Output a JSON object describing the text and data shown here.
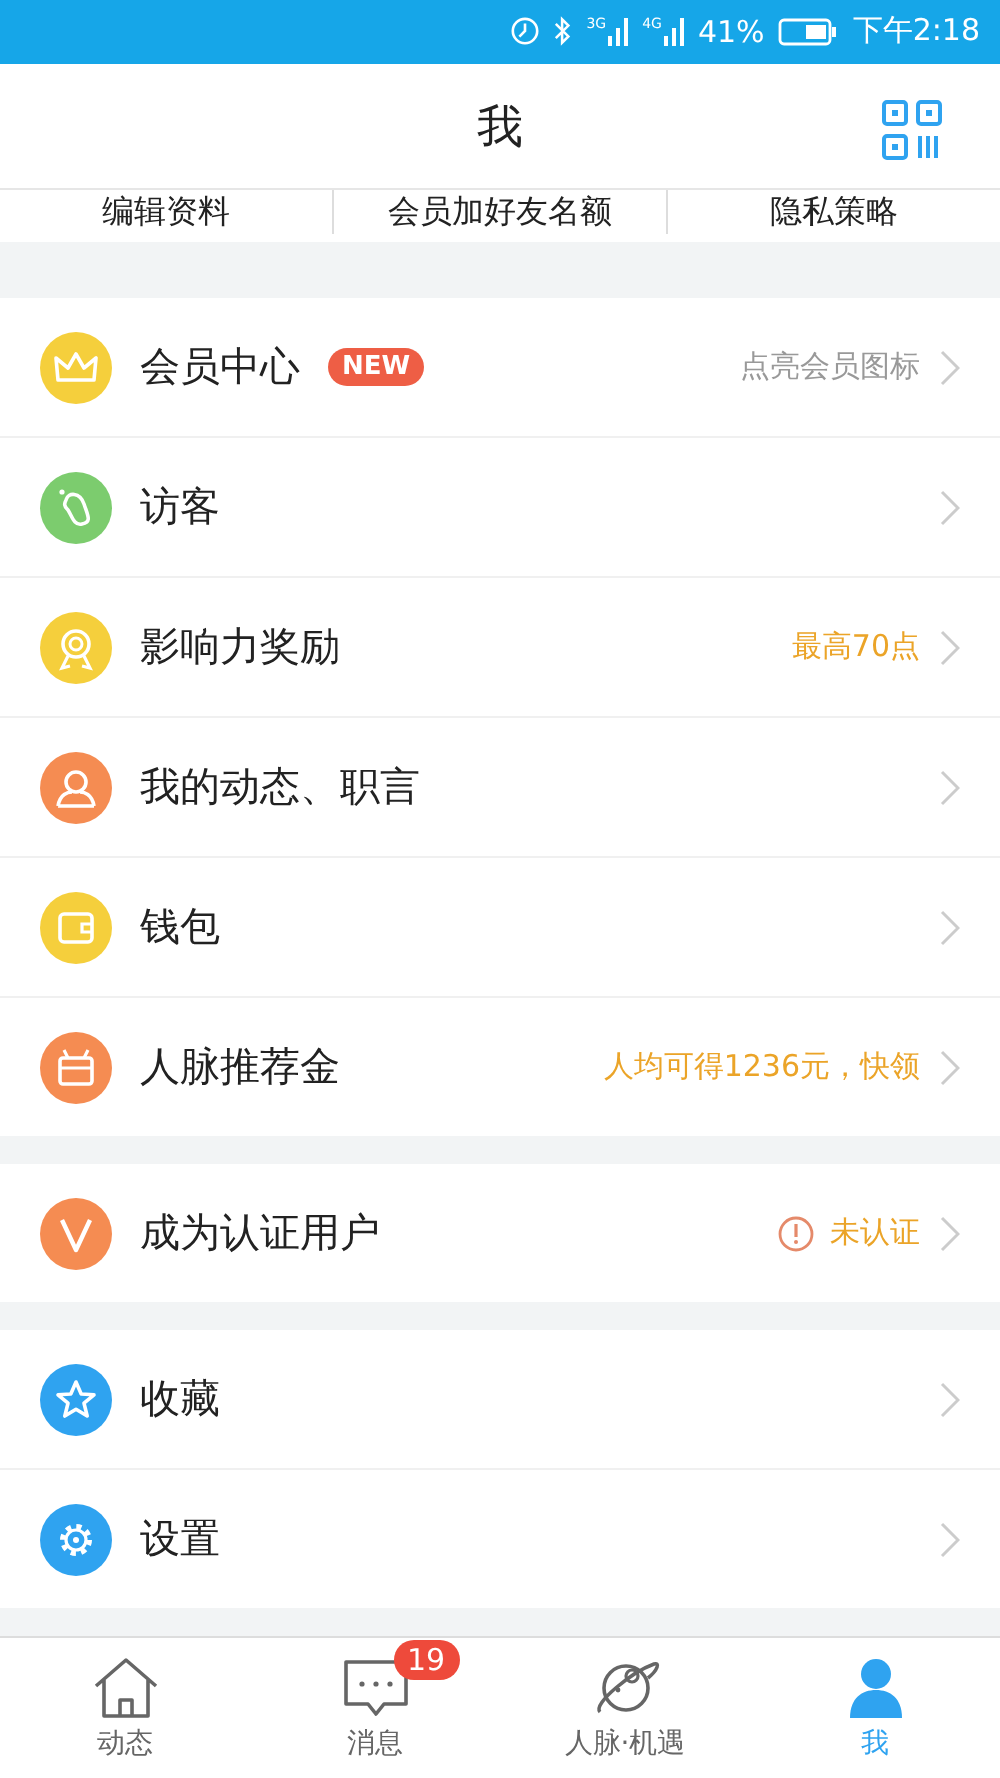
{
  "status_bar": {
    "network_1": "3G",
    "network_2": "4G",
    "battery": "41%",
    "time": "下午2:18"
  },
  "header": {
    "title": "我"
  },
  "quick_links": [
    "编辑资料",
    "会员加好友名额",
    "隐私策略"
  ],
  "groups": [
    {
      "rows": [
        {
          "color": "#f5cf3c",
          "label": "会员中心",
          "badge": "NEW",
          "value": "点亮会员图标",
          "kind": "hint"
        },
        {
          "color": "#7ccc6e",
          "label": "访客",
          "kind": "plain"
        },
        {
          "color": "#f5cf3c",
          "label": "影响力奖励",
          "value": "最高70点",
          "kind": "highlight"
        },
        {
          "color": "#f58c52",
          "label": "我的动态、职言",
          "kind": "plain"
        },
        {
          "color": "#f5cf3c",
          "label": "钱包",
          "kind": "plain"
        },
        {
          "color": "#f58c52",
          "label": "人脉推荐金",
          "value": "人均可得1236元，快领",
          "kind": "highlight"
        }
      ]
    },
    {
      "rows": [
        {
          "color": "#f58c52",
          "label": "成为认证用户",
          "value": "未认证",
          "kind": "warning"
        }
      ]
    },
    {
      "rows": [
        {
          "color": "#2fa3f0",
          "label": "收藏",
          "kind": "plain"
        },
        {
          "color": "#2fa3f0",
          "label": "设置",
          "kind": "plain"
        }
      ]
    }
  ],
  "tabs": [
    {
      "label": "动态",
      "selected": false
    },
    {
      "label": "消息",
      "badge": "19",
      "selected": false
    },
    {
      "label": "人脉·机遇",
      "selected": false
    },
    {
      "label": "我",
      "selected": true
    }
  ]
}
